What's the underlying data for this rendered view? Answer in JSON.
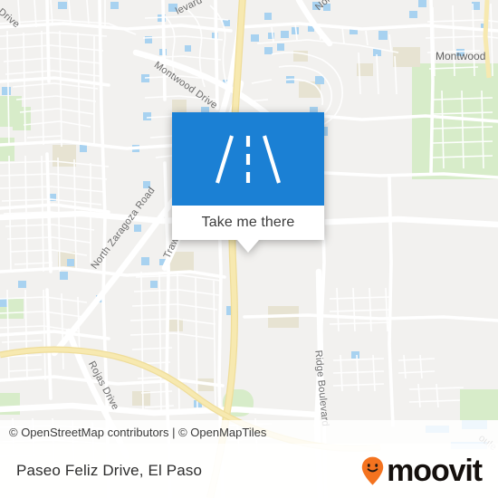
{
  "map": {
    "background_color": "#f2f1ef",
    "road_color": "#ffffff",
    "highway_color": "#f6e6a8",
    "park_color": "#d7ecc9",
    "building_color": "#e7e3d2",
    "water_color": "#a8d2f0",
    "road_labels": [
      {
        "name": "n Drive",
        "full": "Lin Drive"
      },
      {
        "name": "e",
        "full": "Drive"
      },
      {
        "name": "Trawood Drive"
      },
      {
        "name": "Montwood Drive"
      },
      {
        "name": "levard",
        "full": "Boulevard"
      },
      {
        "name": "Nord",
        "full": "North"
      },
      {
        "name": "North Zaragoza Road"
      },
      {
        "name": "Rojas Drive"
      },
      {
        "name": "Ridge Boulevard"
      },
      {
        "name": "oule",
        "full": "Boulevard"
      }
    ],
    "place_labels": [
      {
        "name": "Montwood"
      }
    ]
  },
  "popup": {
    "header_color": "#1b80d4",
    "icon": "road-icon",
    "button_label": "Take me there"
  },
  "attribution": {
    "text": "© OpenStreetMap contributors | © OpenMapTiles"
  },
  "footer": {
    "title": "Paseo Feliz Drive, El Paso",
    "brand_name": "moovit",
    "brand_pin_color": "#f4731f",
    "brand_text_color": "#15100d"
  }
}
